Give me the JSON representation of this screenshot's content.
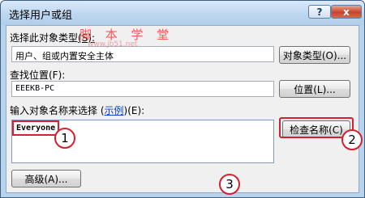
{
  "window": {
    "title": "选择用户或组",
    "help_glyph": "?",
    "close_glyph": "x"
  },
  "object_type": {
    "label": "选择此对象类型",
    "accesskey": "(S):",
    "value": "用户、组或内置安全主体",
    "button": "对象类型(O)..."
  },
  "location": {
    "label": "查找位置(F):",
    "value": "EEEKB-PC",
    "button": "位置(L)..."
  },
  "names": {
    "label_prefix": "输入对象名称来选择 (",
    "link": "示例",
    "label_suffix": ")(E):",
    "entry": "Everyone",
    "check_button": "检查名称(C)"
  },
  "advanced_button": "高级(A)...",
  "callouts": [
    "1",
    "2",
    "3"
  ],
  "watermark": {
    "text": "脚 本 学 堂",
    "url": "www.jb51.net"
  }
}
